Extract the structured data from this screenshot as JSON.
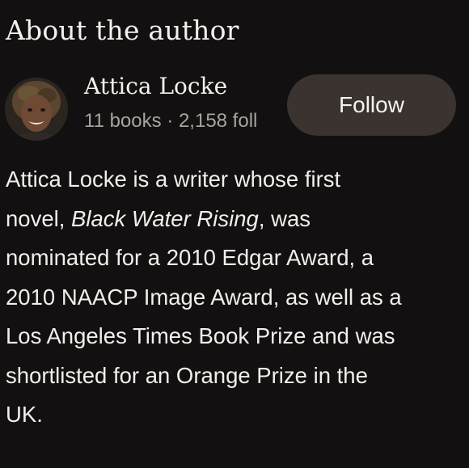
{
  "section": {
    "title": "About the author"
  },
  "author": {
    "name": "Attica Locke",
    "meta": "11 books · 2,158 foll",
    "avatar_icon": "author-photo",
    "follow_label": "Follow"
  },
  "bio": {
    "line1": "Attica Locke is a writer whose first",
    "line2_prefix": "novel, ",
    "line2_title": "Black Water Rising",
    "line2_suffix": ", was",
    "line3": "nominated for a 2010 Edgar Award, a",
    "line4": "2010 NAACP Image Award, as well as a",
    "line5": "Los Angeles Times Book Prize and was",
    "line6": "shortlisted for an Orange Prize in the",
    "line7": "UK."
  },
  "colors": {
    "background": "#121010",
    "text": "#f2efea",
    "muted": "#a8a39d",
    "button_bg": "#3a3330"
  }
}
